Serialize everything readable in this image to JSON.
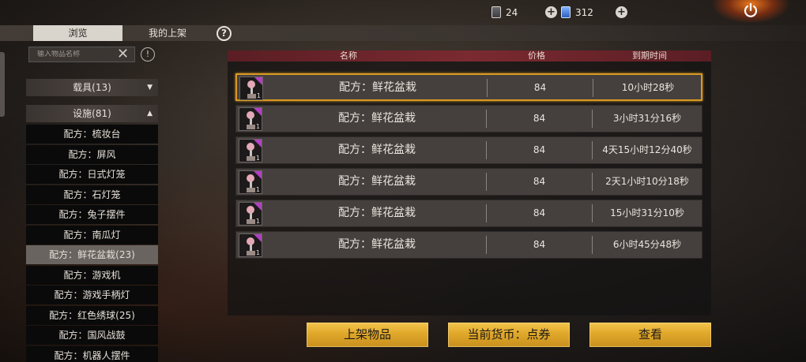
{
  "topbar": {
    "resource1_value": "24",
    "resource2_value": "312"
  },
  "tabs": [
    {
      "label": "浏览",
      "active": true
    },
    {
      "label": "我的上架",
      "active": false
    }
  ],
  "search": {
    "placeholder": "输入物品名称"
  },
  "categories": [
    {
      "label": "载具(13)",
      "arrow": "▼"
    },
    {
      "label": "设施(81)",
      "arrow": "▲"
    }
  ],
  "items": [
    {
      "label": "配方：梳妆台"
    },
    {
      "label": "配方：屏风"
    },
    {
      "label": "配方：日式灯笼"
    },
    {
      "label": "配方：石灯笼"
    },
    {
      "label": "配方：兔子摆件"
    },
    {
      "label": "配方：南瓜灯"
    },
    {
      "label": "配方：鲜花盆栽(23)",
      "selected": true
    },
    {
      "label": "配方：游戏机"
    },
    {
      "label": "配方：游戏手柄灯"
    },
    {
      "label": "配方：红色绣球(25)"
    },
    {
      "label": "配方：国风战鼓"
    },
    {
      "label": "配方：机器人摆件"
    }
  ],
  "table": {
    "headers": {
      "name": "名称",
      "price": "价格",
      "expire": "到期时间"
    },
    "rows": [
      {
        "name": "配方：鲜花盆栽",
        "price": "84",
        "expire": "10小时28秒",
        "qty": "1"
      },
      {
        "name": "配方：鲜花盆栽",
        "price": "84",
        "expire": "3小时31分16秒",
        "qty": "1"
      },
      {
        "name": "配方：鲜花盆栽",
        "price": "84",
        "expire": "4天15小时12分40秒",
        "qty": "1"
      },
      {
        "name": "配方：鲜花盆栽",
        "price": "84",
        "expire": "2天1小时10分18秒",
        "qty": "1"
      },
      {
        "name": "配方：鲜花盆栽",
        "price": "84",
        "expire": "15小时31分10秒",
        "qty": "1"
      },
      {
        "name": "配方：鲜花盆栽",
        "price": "84",
        "expire": "6小时45分48秒",
        "qty": "1"
      }
    ]
  },
  "buttons": {
    "list_item": "上架物品",
    "currency": "当前货币：点券",
    "view": "查看"
  },
  "colors": {
    "accent_gold": "#e0a82a",
    "header_red": "#7a2a30",
    "highlight_border": "#d99a22",
    "rarity_purple": "#b040c0"
  }
}
